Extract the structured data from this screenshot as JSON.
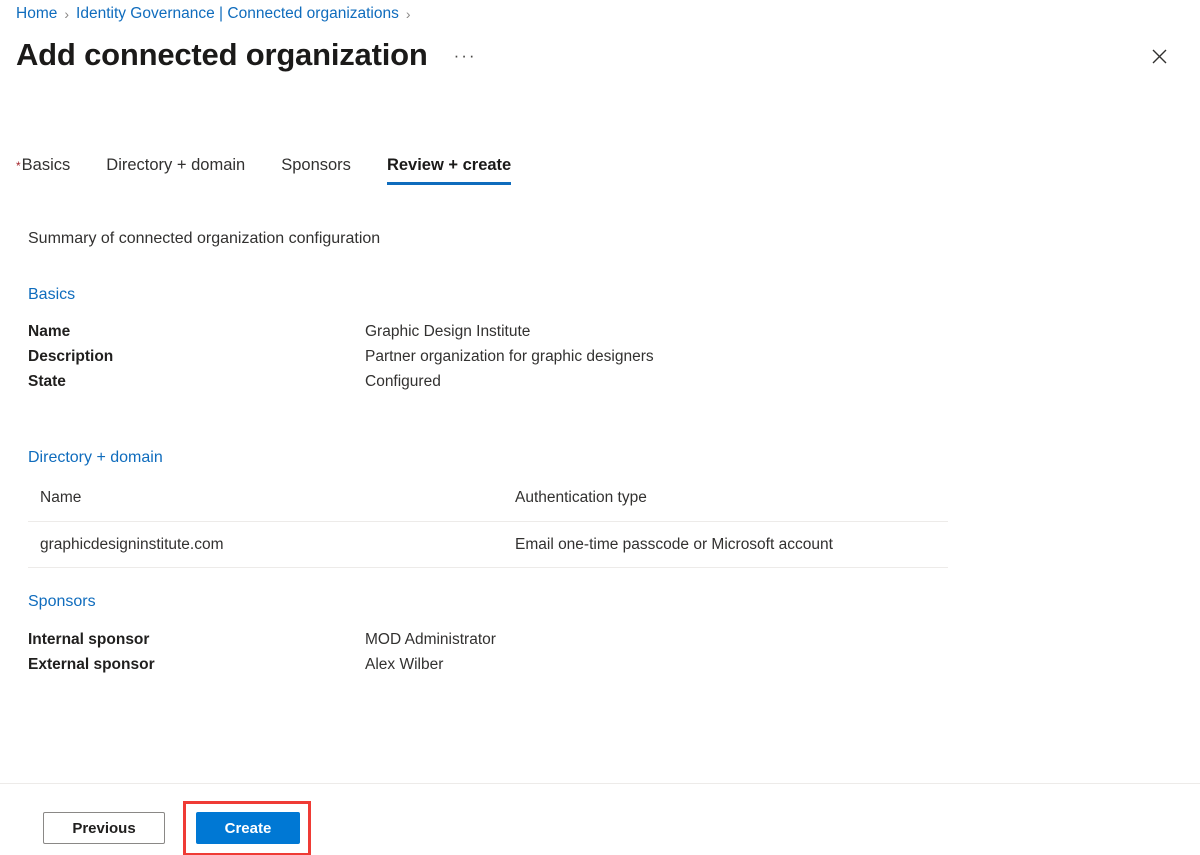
{
  "breadcrumb": {
    "items": [
      {
        "label": "Home"
      },
      {
        "label": "Identity Governance | Connected organizations"
      }
    ],
    "separator": "›"
  },
  "header": {
    "title": "Add connected organization",
    "ellipsis": "···",
    "close_icon": "close-icon"
  },
  "tabs": [
    {
      "label": "Basics",
      "required": true,
      "active": false
    },
    {
      "label": "Directory + domain",
      "required": false,
      "active": false
    },
    {
      "label": "Sponsors",
      "required": false,
      "active": false
    },
    {
      "label": "Review + create",
      "required": false,
      "active": true
    }
  ],
  "main": {
    "summary": "Summary of connected organization configuration",
    "basics": {
      "heading": "Basics",
      "rows": [
        {
          "key": "Name",
          "value": "Graphic Design Institute"
        },
        {
          "key": "Description",
          "value": "Partner organization for graphic designers"
        },
        {
          "key": "State",
          "value": "Configured"
        }
      ]
    },
    "directory_domain": {
      "heading": "Directory + domain",
      "columns": [
        "Name",
        "Authentication type"
      ],
      "rows": [
        {
          "name": "graphicdesigninstitute.com",
          "auth_type": "Email one-time passcode or Microsoft account"
        }
      ]
    },
    "sponsors": {
      "heading": "Sponsors",
      "rows": [
        {
          "key": "Internal sponsor",
          "value": "MOD Administrator"
        },
        {
          "key": "External sponsor",
          "value": "Alex Wilber"
        }
      ]
    }
  },
  "footer": {
    "previous_label": "Previous",
    "create_label": "Create"
  },
  "colors": {
    "link": "#0f6cbd",
    "primary_button": "#0078d4",
    "required_star": "#a4262c",
    "highlight_box": "#ef3b35",
    "divider": "#edebe9"
  }
}
